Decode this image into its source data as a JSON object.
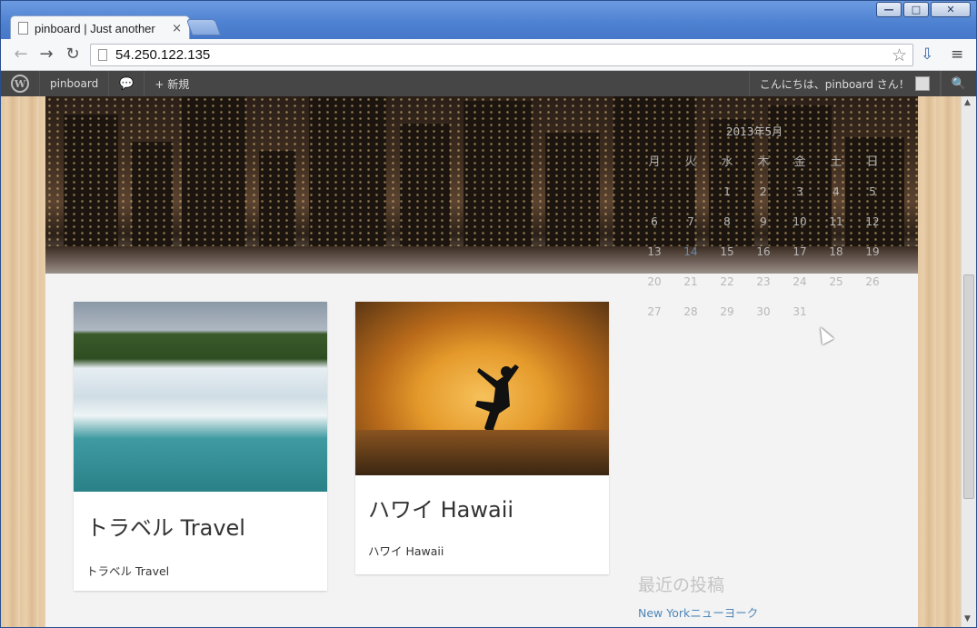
{
  "browser": {
    "tab_title": "pinboard | Just another",
    "tab_close": "×",
    "url": "54.250.122.135",
    "window_buttons": [
      "—",
      "□",
      "✕"
    ]
  },
  "adminbar": {
    "site_name": "pinboard",
    "new_label": "+ 新規",
    "greeting": "こんにちは、pinboard さん！"
  },
  "posts": [
    {
      "title": "トラベル Travel",
      "excerpt": "トラベル Travel"
    },
    {
      "title": "ハワイ Hawaii",
      "excerpt": "ハワイ Hawaii"
    }
  ],
  "calendar": {
    "caption": "2013年5月",
    "weekdays": [
      "月",
      "火",
      "水",
      "木",
      "金",
      "土",
      "日"
    ],
    "rows": [
      [
        "",
        "",
        "1",
        "2",
        "3",
        "4",
        "5"
      ],
      [
        "6",
        "7",
        "8",
        "9",
        "10",
        "11",
        "12"
      ],
      [
        "13",
        "14",
        "15",
        "16",
        "17",
        "18",
        "19"
      ],
      [
        "20",
        "21",
        "22",
        "23",
        "24",
        "25",
        "26"
      ],
      [
        "27",
        "28",
        "29",
        "30",
        "31",
        "",
        ""
      ]
    ],
    "linked_day": "14"
  },
  "sidebar": {
    "recent_heading": "最近の投稿",
    "recent_items": [
      "New Yorkニューヨーク"
    ]
  },
  "colors": {
    "adminbar_bg": "#464646",
    "link": "#4f86b8",
    "page_bg": "#f3f3f3"
  }
}
